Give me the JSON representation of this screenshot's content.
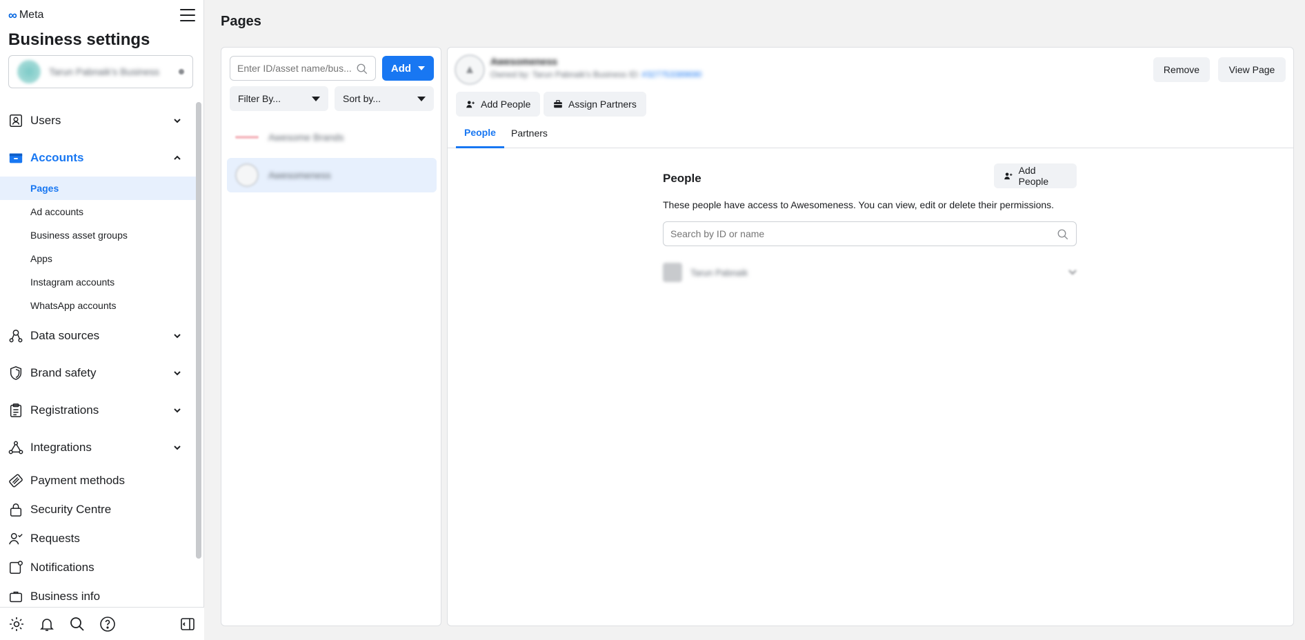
{
  "sidebar": {
    "brand": "Meta",
    "title": "Business settings",
    "business_name": "Tarun Pabnaik's Business",
    "groups": [
      {
        "label": "Users"
      },
      {
        "label": "Accounts"
      },
      {
        "label": "Data sources"
      },
      {
        "label": "Brand safety"
      },
      {
        "label": "Registrations"
      },
      {
        "label": "Integrations"
      },
      {
        "label": "Payment methods"
      },
      {
        "label": "Security Centre"
      },
      {
        "label": "Requests"
      },
      {
        "label": "Notifications"
      },
      {
        "label": "Business info"
      }
    ],
    "accounts_items": [
      "Pages",
      "Ad accounts",
      "Business asset groups",
      "Apps",
      "Instagram accounts",
      "WhatsApp accounts"
    ]
  },
  "main": {
    "page_title": "Pages",
    "list": {
      "search_placeholder": "Enter ID/asset name/bus...",
      "add_label": "Add",
      "filter_label": "Filter By...",
      "sort_label": "Sort by...",
      "assets": [
        {
          "name": "Awesome Brands"
        },
        {
          "name": "Awesomeness"
        }
      ]
    },
    "detail": {
      "name": "Awesomeness",
      "owned_by": "Owned by: Tarun Pabnaik's Business",
      "id_label": "ID:",
      "id_value": "#327753389690",
      "remove_label": "Remove",
      "view_page_label": "View Page",
      "add_people_label": "Add People",
      "assign_partners_label": "Assign Partners",
      "tabs": [
        "People",
        "Partners"
      ],
      "people": {
        "title": "People",
        "add_people_label": "Add People",
        "description": "These people have access to Awesomeness. You can view, edit or delete their permissions.",
        "search_placeholder": "Search by ID or name",
        "members": [
          {
            "name": "Tarun Pabnaik"
          }
        ]
      }
    }
  },
  "colors": {
    "accent": "#1877f2",
    "selected_bg": "#e7f0fd"
  }
}
